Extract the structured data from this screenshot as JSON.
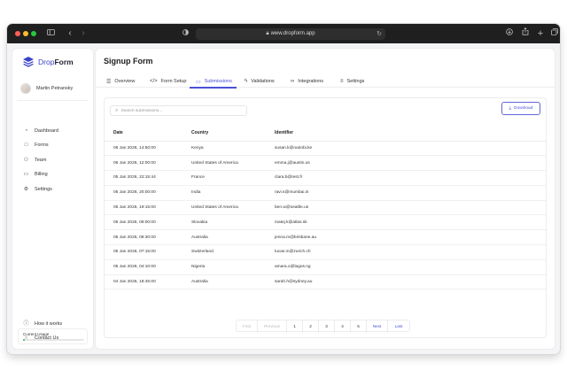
{
  "browser": {
    "url": "www.dropform.app"
  },
  "sidebar": {
    "brand_part1": "Drop",
    "brand_part2": "Form",
    "user_name": "Martin Petransky",
    "nav": [
      {
        "label": "Dashboard",
        "icon": "gauge-icon"
      },
      {
        "label": "Forms",
        "icon": "document-icon"
      },
      {
        "label": "Team",
        "icon": "team-icon"
      },
      {
        "label": "Billing",
        "icon": "card-icon"
      },
      {
        "label": "Settings",
        "icon": "gears-icon"
      }
    ],
    "bottom_nav": [
      {
        "label": "How it works",
        "icon": "help-circle-icon"
      },
      {
        "label": "Contact Us",
        "icon": "chat-bubble-icon"
      }
    ],
    "usage_label": "Current Usage",
    "usage_fraction": 0.03,
    "usage_color": "#2fb65c"
  },
  "main": {
    "title": "Signup Form",
    "tabs": [
      {
        "label": "Overview",
        "icon": "chart-icon"
      },
      {
        "label": "Form Setup",
        "icon": "code-icon"
      },
      {
        "label": "Submissions",
        "icon": "inbox-icon",
        "active": true
      },
      {
        "label": "Validations",
        "icon": "bolt-icon"
      },
      {
        "label": "Integrations",
        "icon": "link-icon"
      },
      {
        "label": "Settings",
        "icon": "sliders-icon"
      }
    ],
    "accent_color": "#4a52d6",
    "search_placeholder": "Search submissions...",
    "download_label": "Download",
    "columns": [
      "Date",
      "Country",
      "Identifier"
    ],
    "rows": [
      [
        "06 Jan 2026, 14:50:00",
        "Kenya",
        "susan.k@nairobi.ke"
      ],
      [
        "06 Jan 2026, 12:00:00",
        "United States of America",
        "emma.j@austin.us"
      ],
      [
        "05 Jan 2026, 22:15:44",
        "France",
        "clara.b@test.fr"
      ],
      [
        "05 Jan 2026, 20:00:00",
        "India",
        "ravi.s@mumbai.in"
      ],
      [
        "05 Jan 2026, 19:15:00",
        "United States of America",
        "ben.w@seattle.us"
      ],
      [
        "05 Jan 2026, 09:00:00",
        "Slovakia",
        "matej.k@atlas.sk"
      ],
      [
        "05 Jan 2026, 08:30:00",
        "Australia",
        "jenna.m@brisbane.au"
      ],
      [
        "05 Jan 2026, 07:15:00",
        "Switzerland",
        "lucas.m@zurich.ch"
      ],
      [
        "05 Jan 2026, 04:10:00",
        "Nigeria",
        "amara.o@lagos.ng"
      ],
      [
        "04 Jan 2026, 18:45:00",
        "Australia",
        "sarah.h@sydney.au"
      ]
    ],
    "pagination": {
      "first": "First",
      "previous": "Previous",
      "pages": [
        "1",
        "2",
        "3",
        "4",
        "5"
      ],
      "next": "Next",
      "last": "Last"
    }
  }
}
